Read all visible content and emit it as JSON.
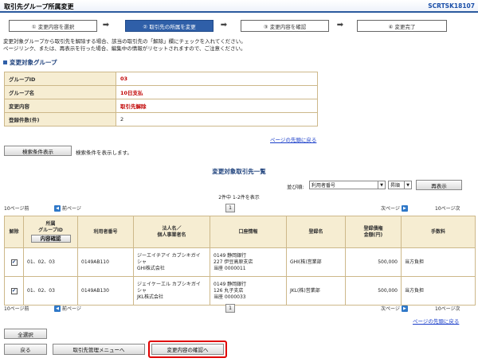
{
  "window": {
    "title": "取引先グループ所属変更",
    "screen_id": "SCRTSK18107"
  },
  "steps": [
    {
      "label": "① 変更内容を選択",
      "active": false
    },
    {
      "label": "② 取引先の所属を変更",
      "active": true
    },
    {
      "label": "③ 変更内容を確認",
      "active": false
    },
    {
      "label": "④ 変更完了",
      "active": false
    }
  ],
  "arrow_glyph": "➡",
  "description": {
    "line1": "変更対象グループから取引先を解除する場合、該当の取引先の「解除」欄にチェックを入れてください。",
    "line2": "ページリンク、または、再表示を行った場合、編集中の情報がリセットされますので、ご注意ください。"
  },
  "group_section": {
    "heading": "変更対象グループ",
    "rows": [
      {
        "label": "グループID",
        "value": "03"
      },
      {
        "label": "グループ名",
        "value": "10日支払"
      },
      {
        "label": "変更内容",
        "value": "取引先解除"
      },
      {
        "label": "登録件数(件)",
        "value": "2"
      }
    ],
    "top_link": "ページの先頭に戻る"
  },
  "search": {
    "button": "検索条件表示",
    "hint": "検索条件を表示します。"
  },
  "list_section": {
    "title": "変更対象取引先一覧",
    "sort_label": "並び順:",
    "sort_value": "利用者番号",
    "order_value": "昇順",
    "redisplay_button": "再表示",
    "count_text": "2件中 1-2件を表示",
    "pager": {
      "prev10": "10ページ前",
      "prev": "前ページ",
      "page": "1",
      "next": "次ページ",
      "next10": "10ページ次"
    },
    "headers": {
      "release": "解除",
      "group_id_line1": "所属",
      "group_id_line2": "グループID",
      "detail_button": "内容確認",
      "user_no": "利用者番号",
      "name_line1": "法人名／",
      "name_line2": "個人事業者名",
      "account": "口座情報",
      "reg_name": "登録名",
      "amount_line1": "登録債権",
      "amount_line2": "金額(円)",
      "fee": "手数料"
    },
    "rows": [
      {
        "checked": "✔",
        "group_id": "01、02、03",
        "user_no": "0149AB110",
        "name_kana_1": "ジーエイチアイ カブシキガイ",
        "name_kana_2": "シャ",
        "name": "GHI株式会社",
        "bank": "0149 静岡銀行",
        "branch": "227 伊豆高原支店",
        "acct": "当座 0000011",
        "reg_name": "GHI(株)営業部",
        "amount": "500,000",
        "fee": "当方負担"
      },
      {
        "checked": "✔",
        "group_id": "01、02、03",
        "user_no": "0149AB130",
        "name_kana_1": "ジェイケーエル カブシキガイ",
        "name_kana_2": "シャ",
        "name": "JKL株式会社",
        "bank": "0149 静岡銀行",
        "branch": "126 丸子支店",
        "acct": "当座 0000033",
        "reg_name": "JKL(株)営業部",
        "amount": "500,000",
        "fee": "当方負担"
      }
    ],
    "top_link": "ページの先頭に戻る"
  },
  "footer": {
    "select_all": "全選択",
    "back": "戻る",
    "menu": "取引先管理メニューへ",
    "confirm": "変更内容の確認へ"
  },
  "colors": {
    "accent": "#2f5fa8",
    "highlight": "#e00000",
    "value_red": "#c00000"
  }
}
